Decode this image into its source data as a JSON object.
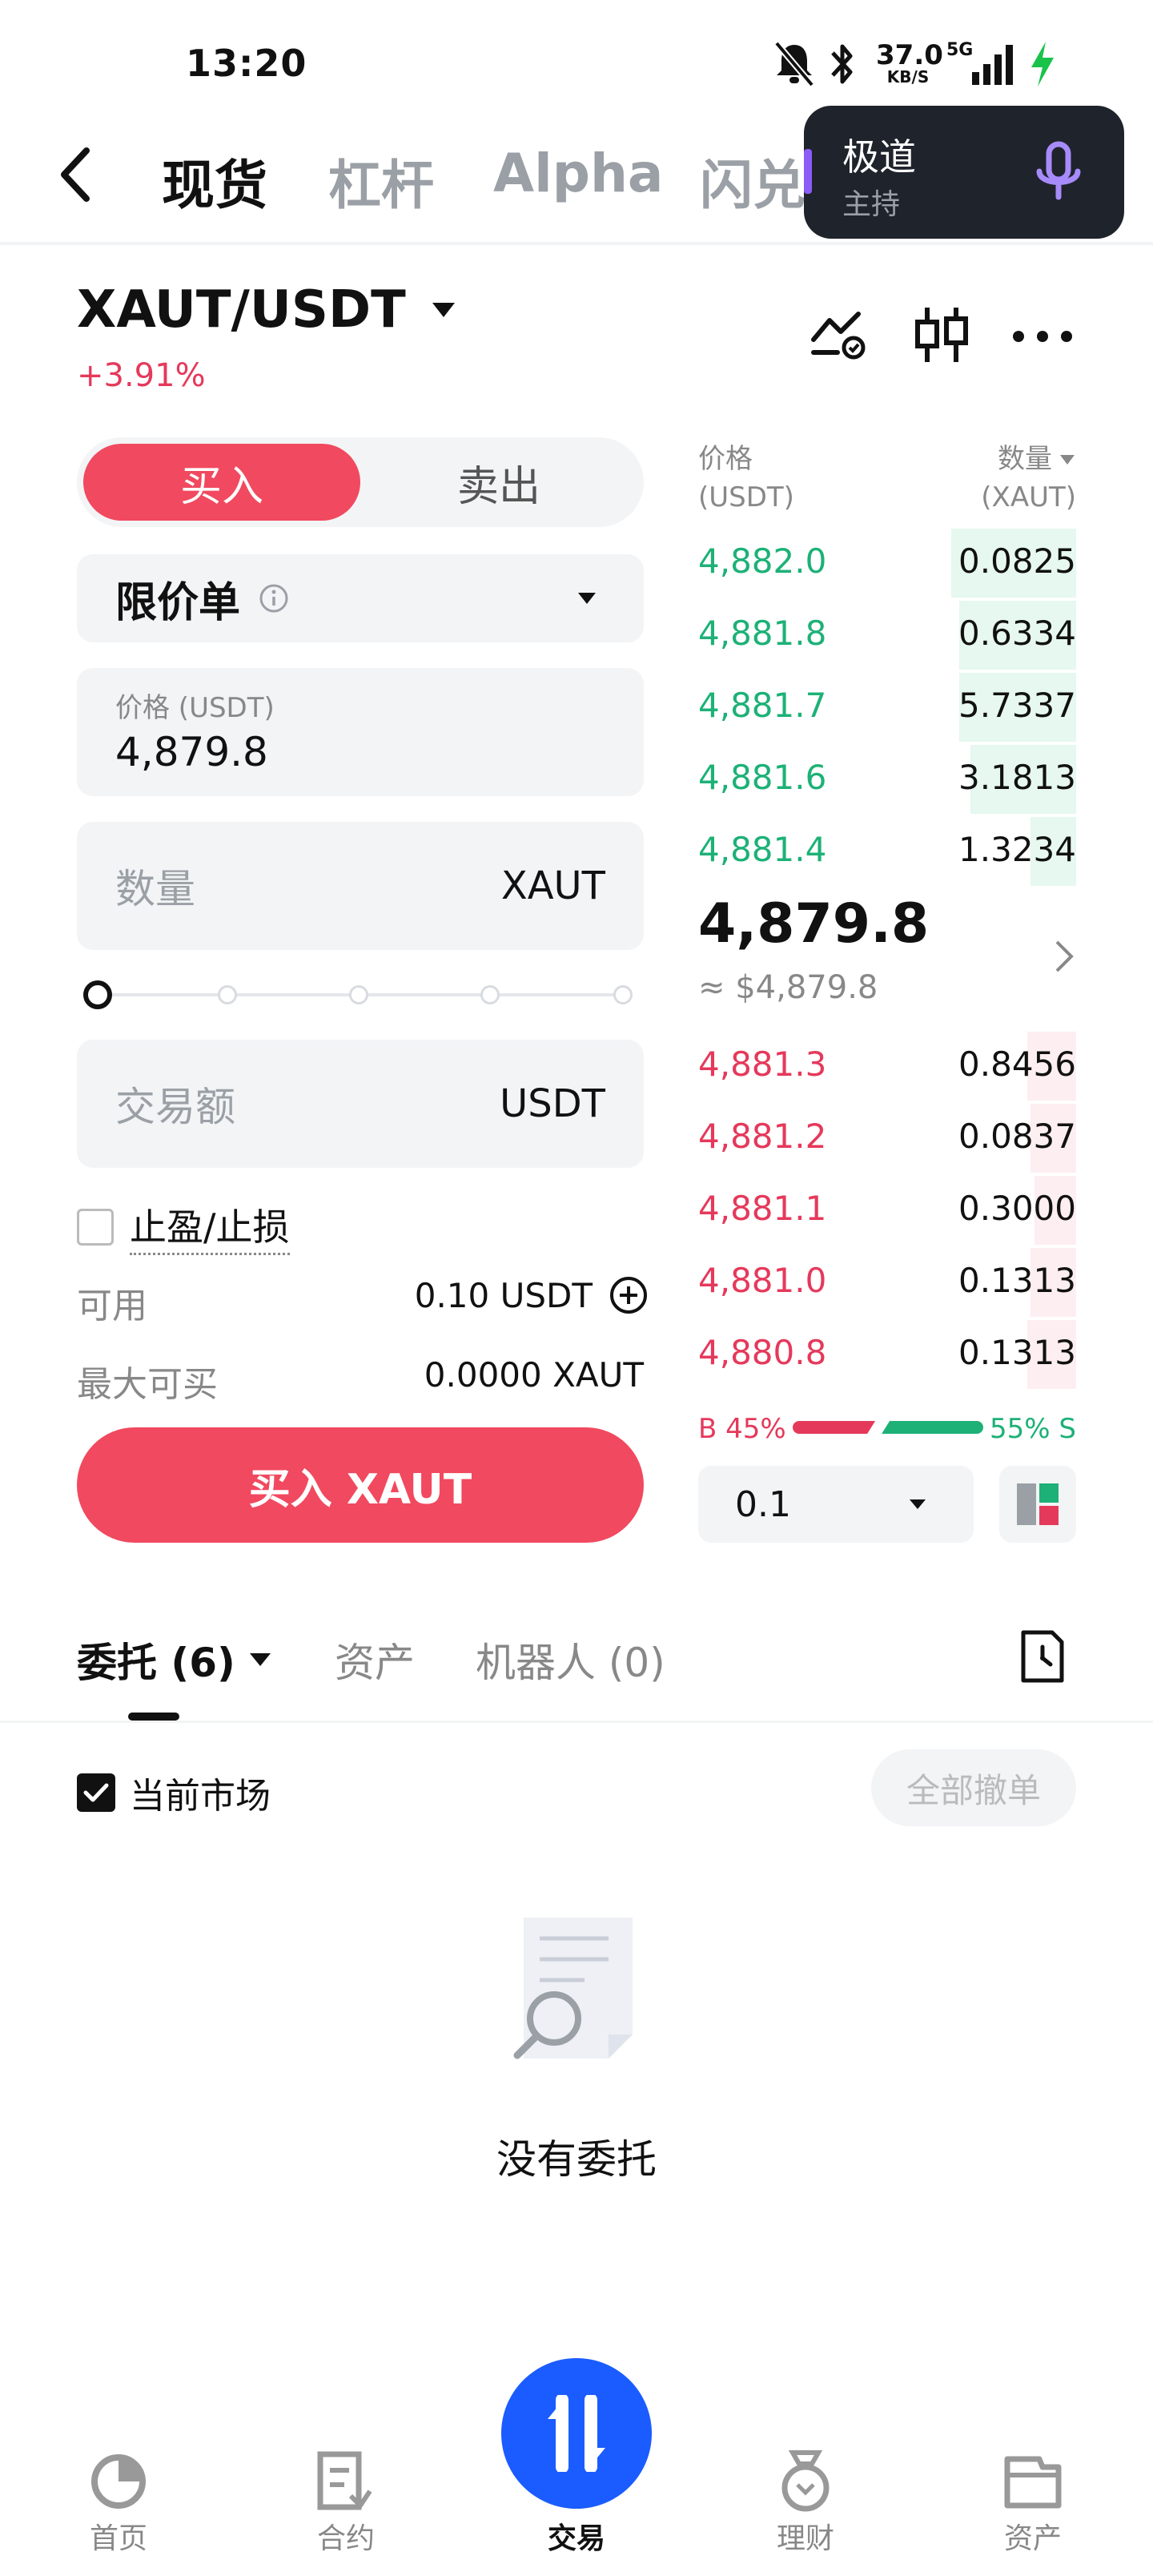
{
  "status_bar": {
    "time": "13:20",
    "net_speed_value": "37.0",
    "net_speed_unit": "KB/S",
    "network": "5G",
    "icons": [
      "mute-bell-icon",
      "bluetooth-icon",
      "signal-icon",
      "charging-icon"
    ]
  },
  "nav": {
    "back_icon": "chevron-left-icon",
    "tabs": [
      "现货",
      "杠杆",
      "Alpha",
      "闪兑"
    ],
    "active_tab": "现货"
  },
  "voice_overlay": {
    "title": "极道",
    "subtitle": "主持",
    "icon": "microphone-icon"
  },
  "pair": {
    "symbol": "XAUT/USDT",
    "change": "+3.91%",
    "icons": [
      "price-alert-icon",
      "candlestick-chart-icon",
      "more-icon"
    ]
  },
  "order_form": {
    "buy_label": "买入",
    "sell_label": "卖出",
    "order_type": "限价单",
    "price_label": "价格 (USDT)",
    "price_value": "4,879.8",
    "qty_placeholder": "数量",
    "qty_unit": "XAUT",
    "amount_placeholder": "交易额",
    "amount_unit": "USDT",
    "tpsl_label": "止盈/止损",
    "available_label": "可用",
    "available_value": "0.10 USDT",
    "max_buy_label": "最大可买",
    "max_buy_value": "0.0000 XAUT",
    "submit_label": "买入 XAUT"
  },
  "order_book": {
    "price_header": "价格",
    "price_unit": "(USDT)",
    "qty_header": "数量",
    "qty_unit": "(XAUT)",
    "asks": [
      {
        "price": "4,882.0",
        "qty": "0.0825",
        "depth": 0.33
      },
      {
        "price": "4,881.8",
        "qty": "0.6334",
        "depth": 0.31
      },
      {
        "price": "4,881.7",
        "qty": "5.7337",
        "depth": 0.31
      },
      {
        "price": "4,881.6",
        "qty": "3.1813",
        "depth": 0.28
      },
      {
        "price": "4,881.4",
        "qty": "1.3234",
        "depth": 0.12
      }
    ],
    "last_price": "4,879.8",
    "last_price_usd": "≈ $4,879.8",
    "bids": [
      {
        "price": "4,881.3",
        "qty": "0.8456",
        "depth": 0.13
      },
      {
        "price": "4,881.2",
        "qty": "0.0837",
        "depth": 0.12
      },
      {
        "price": "4,881.1",
        "qty": "0.3000",
        "depth": 0.11
      },
      {
        "price": "4,881.0",
        "qty": "0.1313",
        "depth": 0.12
      },
      {
        "price": "4,880.8",
        "qty": "0.1313",
        "depth": 0.13
      }
    ],
    "buy_ratio_label": "B 45%",
    "sell_ratio_label": "55% S",
    "buy_ratio": 0.45,
    "precision": "0.1"
  },
  "orders_section": {
    "tabs": [
      "委托 (6)",
      "资产",
      "机器人 (0)"
    ],
    "current_market_label": "当前市场",
    "cancel_all_label": "全部撤单",
    "empty_text": "没有委托"
  },
  "bottom_nav": {
    "items": [
      "首页",
      "合约",
      "交易",
      "理财",
      "资产"
    ],
    "active": "交易"
  },
  "colors": {
    "buy": "#f1495f",
    "green": "#1db177",
    "red": "#e5395b",
    "active_nav": "#1a5cff"
  }
}
